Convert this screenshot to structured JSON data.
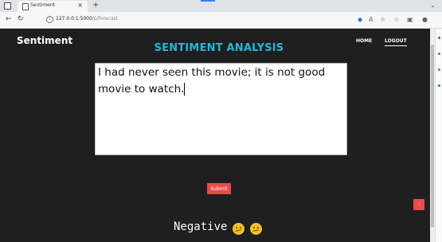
{
  "browser": {
    "tab_title": "Sentiment",
    "tab_close": "×",
    "new_tab": "+",
    "url_host": "127.0.0.1:5000",
    "url_path": "/p/forecast",
    "back": "←",
    "reload": "↻",
    "info": "i"
  },
  "header": {
    "brand": "Sentiment",
    "title": "SENTIMENT ANALYSIS",
    "nav": {
      "home": "HOME",
      "logout": "LOGOUT"
    }
  },
  "form": {
    "review_text": "I had never seen this movie; it is not good movie to watch.",
    "submit_label": "Submit"
  },
  "result": {
    "label": "Negative",
    "emoji_icons": [
      "confused-face-icon",
      "confused-face-icon"
    ]
  },
  "scroll_top_label": "↑",
  "colors": {
    "page_bg": "#1f1f1f",
    "title": "#28b6d8",
    "button": "#ea4a4a",
    "emoji": "#f4c12d"
  }
}
